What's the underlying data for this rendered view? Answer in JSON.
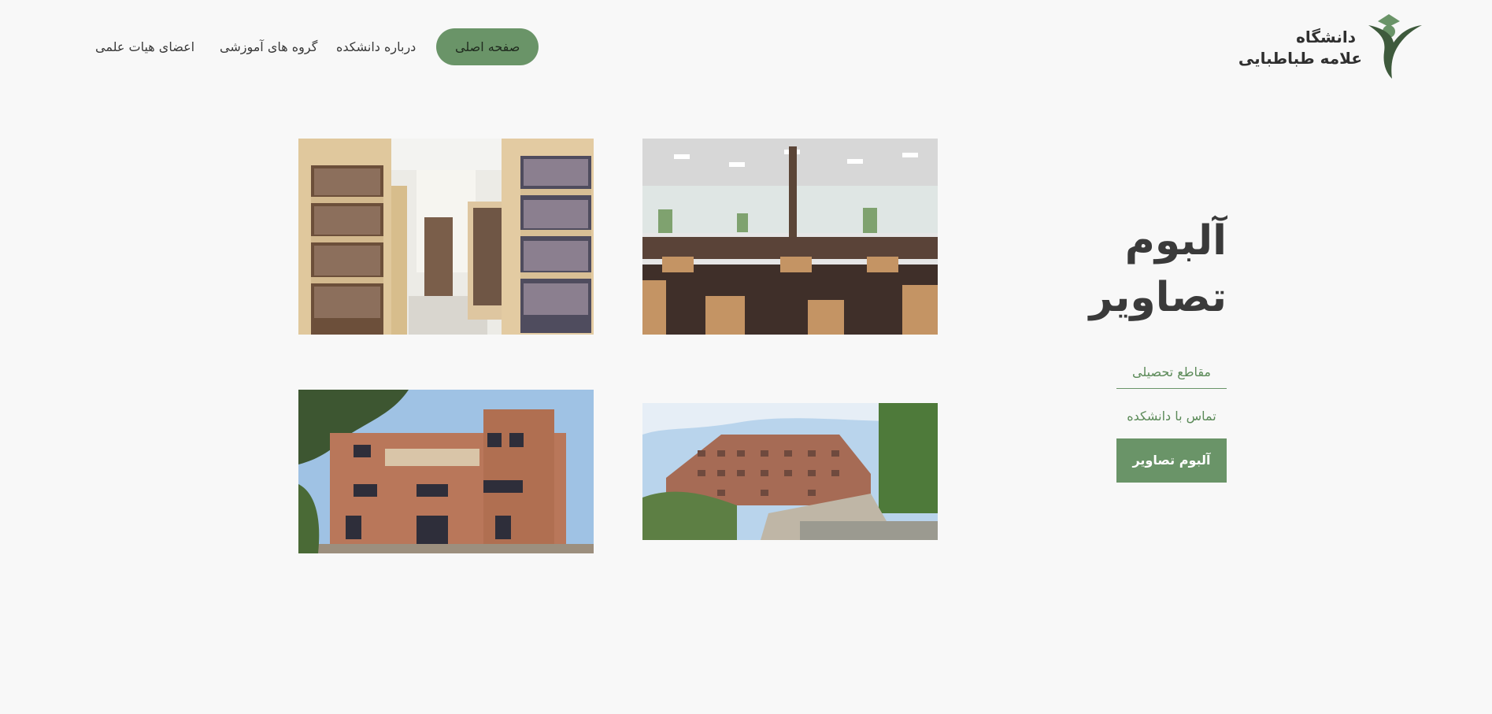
{
  "logo": {
    "line1": "دانشگاه",
    "line2": "علامه طباطبایی",
    "icon": "graduate-figure-logo",
    "brand_color": "#6a9468"
  },
  "nav": {
    "items": [
      {
        "label": "صفحه اصلی",
        "active": true
      },
      {
        "label": "درباره دانشکده",
        "active": false
      },
      {
        "label": "گروه های آموزشی",
        "active": false
      },
      {
        "label": "اعضای هیات علمی",
        "active": false
      }
    ]
  },
  "album": {
    "title_line1": "آلبوم",
    "title_line2": "تصاویر"
  },
  "side_menu": {
    "items": [
      {
        "label": "مقاطع تحصیلی",
        "active": false
      },
      {
        "label": "تماس با دانشکده",
        "active": false
      },
      {
        "label": "آلبوم تصاویر",
        "active": true
      }
    ]
  },
  "colors": {
    "accent": "#6a9468",
    "background": "#f8f8f8",
    "text": "#3a3a3a"
  }
}
